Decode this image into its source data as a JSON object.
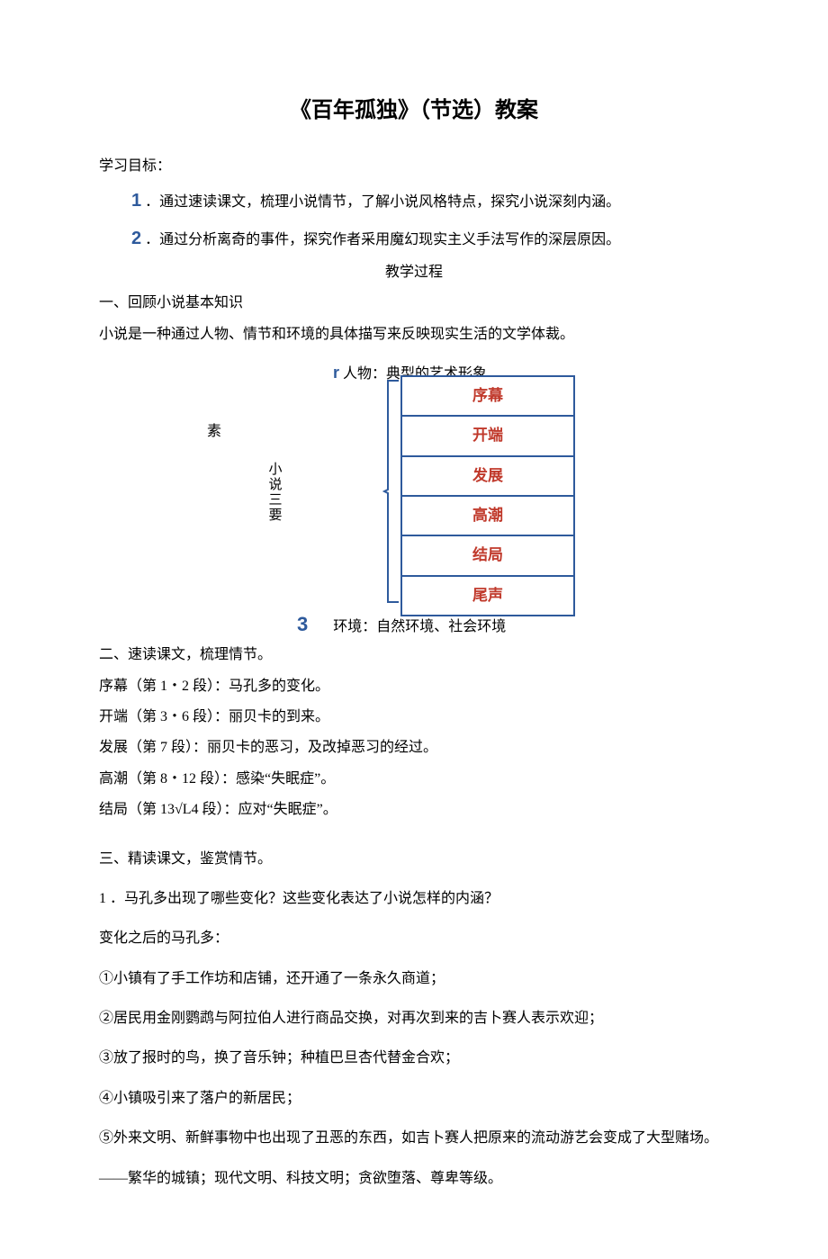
{
  "title": "《百年孤独》（节选）教案",
  "goals_heading": "学习目标：",
  "goal1": "．通过速读课文，梳理小说情节，了解小说风格特点，探究小说深刻内涵。",
  "goal2": "．通过分析离奇的事件，探究作者采用魔幻现实主义手法写作的深层原因。",
  "process_heading": "教学过程",
  "section1": "一、回顾小说基本知识",
  "novel_def": "小说是一种通过人物、情节和环境的具体描写来反映现实生活的文学体裁。",
  "diagram": {
    "r_text": "人物：典型的艺术形象",
    "left_label": "素",
    "vert_label": "小说三要",
    "plot_items": [
      "序幕",
      "开端",
      "发展",
      "高潮",
      "结局",
      "尾声"
    ],
    "env_num": "3",
    "env_text": "环境：自然环境、社会环境"
  },
  "section2_heading": "二、速读课文，梳理情节。",
  "plot_lines": [
    "序幕（第 1・2 段）：马孔多的变化。",
    "开端（第 3・6 段）：丽贝卡的到来。",
    "发展（第 7 段）：丽贝卡的恶习，及改掉恶习的经过。",
    "高潮（第 8・12 段）：感染“失眠症”。",
    "结局（第 13√L4 段）：应对“失眠症”。"
  ],
  "section3_heading": "三、精读课文，鉴赏情节。",
  "q1": "1 ．马孔多出现了哪些变化？这些变化表达了小说怎样的内涵？",
  "q1_sub": "变化之后的马孔多：",
  "q1_items": [
    "①小镇有了手工作坊和店铺，还开通了一条永久商道；",
    "②居民用金刚鹦鹉与阿拉伯人进行商品交换，对再次到来的吉卜赛人表示欢迎；",
    "③放了报时的鸟，换了音乐钟；种植巴旦杏代替金合欢；",
    "④小镇吸引来了落户的新居民；",
    "⑤外来文明、新鲜事物中也出现了丑恶的东西，如吉卜赛人把原来的流动游艺会变成了大型赌场。"
  ],
  "q1_conclusion": "——繁华的城镇；现代文明、科技文明；贪欲堕落、尊卑等级。"
}
